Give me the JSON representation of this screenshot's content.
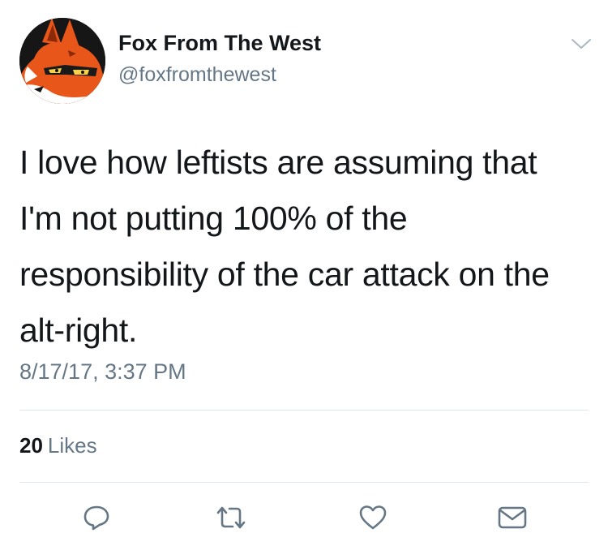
{
  "tweet": {
    "display_name": "Fox From The West",
    "handle": "@foxfromthewest",
    "text_lines": [
      "I love how leftists are assuming that",
      "I'm not putting 100% of the",
      "responsibility of the car attack on the",
      "alt-right."
    ],
    "timestamp": "8/17/17, 3:37 PM",
    "likes_count": "20",
    "likes_label": "Likes"
  },
  "icons": {
    "menu": "chevron-down-icon",
    "reply": "reply-icon",
    "retweet": "retweet-icon",
    "like": "heart-icon",
    "message": "envelope-icon",
    "avatar": "fox-avatar"
  },
  "colors": {
    "text": "#14171a",
    "secondary": "#657786",
    "icon": "#657786",
    "divider": "#e1e8ed",
    "fox_orange": "#e8561a"
  }
}
